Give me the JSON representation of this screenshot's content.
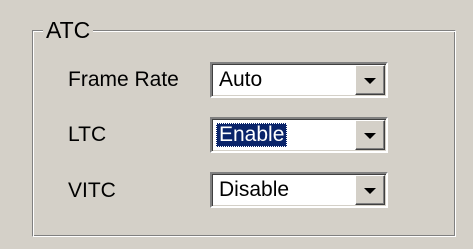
{
  "group": {
    "title": "ATC"
  },
  "fields": [
    {
      "label": "Frame Rate",
      "value": "Auto",
      "selected": false,
      "arrow_icon": "chevron-down-icon"
    },
    {
      "label": "LTC",
      "value": "Enable",
      "selected": true,
      "arrow_icon": "chevron-down-icon"
    },
    {
      "label": "VITC",
      "value": "Disable",
      "selected": false,
      "arrow_icon": "chevron-down-icon"
    }
  ],
  "colors": {
    "face": "#d4d0c8",
    "selection": "#0a246a",
    "field_bg": "#ffffff"
  }
}
